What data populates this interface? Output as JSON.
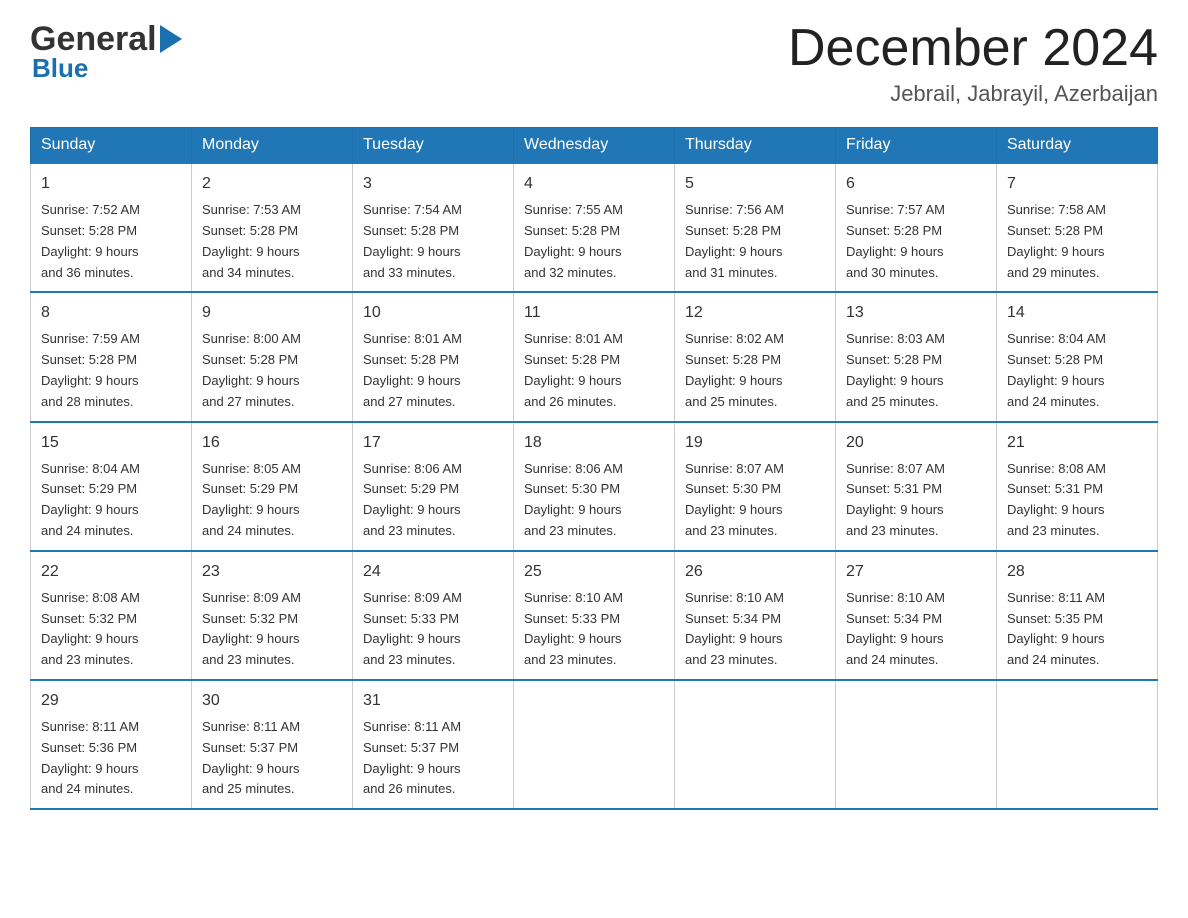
{
  "header": {
    "logo_line1": "General",
    "logo_arrow": "▶",
    "logo_line2": "Blue",
    "month_title": "December 2024",
    "location": "Jebrail, Jabrayil, Azerbaijan"
  },
  "calendar": {
    "days_of_week": [
      "Sunday",
      "Monday",
      "Tuesday",
      "Wednesday",
      "Thursday",
      "Friday",
      "Saturday"
    ],
    "weeks": [
      [
        {
          "day": "1",
          "info": "Sunrise: 7:52 AM\nSunset: 5:28 PM\nDaylight: 9 hours\nand 36 minutes."
        },
        {
          "day": "2",
          "info": "Sunrise: 7:53 AM\nSunset: 5:28 PM\nDaylight: 9 hours\nand 34 minutes."
        },
        {
          "day": "3",
          "info": "Sunrise: 7:54 AM\nSunset: 5:28 PM\nDaylight: 9 hours\nand 33 minutes."
        },
        {
          "day": "4",
          "info": "Sunrise: 7:55 AM\nSunset: 5:28 PM\nDaylight: 9 hours\nand 32 minutes."
        },
        {
          "day": "5",
          "info": "Sunrise: 7:56 AM\nSunset: 5:28 PM\nDaylight: 9 hours\nand 31 minutes."
        },
        {
          "day": "6",
          "info": "Sunrise: 7:57 AM\nSunset: 5:28 PM\nDaylight: 9 hours\nand 30 minutes."
        },
        {
          "day": "7",
          "info": "Sunrise: 7:58 AM\nSunset: 5:28 PM\nDaylight: 9 hours\nand 29 minutes."
        }
      ],
      [
        {
          "day": "8",
          "info": "Sunrise: 7:59 AM\nSunset: 5:28 PM\nDaylight: 9 hours\nand 28 minutes."
        },
        {
          "day": "9",
          "info": "Sunrise: 8:00 AM\nSunset: 5:28 PM\nDaylight: 9 hours\nand 27 minutes."
        },
        {
          "day": "10",
          "info": "Sunrise: 8:01 AM\nSunset: 5:28 PM\nDaylight: 9 hours\nand 27 minutes."
        },
        {
          "day": "11",
          "info": "Sunrise: 8:01 AM\nSunset: 5:28 PM\nDaylight: 9 hours\nand 26 minutes."
        },
        {
          "day": "12",
          "info": "Sunrise: 8:02 AM\nSunset: 5:28 PM\nDaylight: 9 hours\nand 25 minutes."
        },
        {
          "day": "13",
          "info": "Sunrise: 8:03 AM\nSunset: 5:28 PM\nDaylight: 9 hours\nand 25 minutes."
        },
        {
          "day": "14",
          "info": "Sunrise: 8:04 AM\nSunset: 5:28 PM\nDaylight: 9 hours\nand 24 minutes."
        }
      ],
      [
        {
          "day": "15",
          "info": "Sunrise: 8:04 AM\nSunset: 5:29 PM\nDaylight: 9 hours\nand 24 minutes."
        },
        {
          "day": "16",
          "info": "Sunrise: 8:05 AM\nSunset: 5:29 PM\nDaylight: 9 hours\nand 24 minutes."
        },
        {
          "day": "17",
          "info": "Sunrise: 8:06 AM\nSunset: 5:29 PM\nDaylight: 9 hours\nand 23 minutes."
        },
        {
          "day": "18",
          "info": "Sunrise: 8:06 AM\nSunset: 5:30 PM\nDaylight: 9 hours\nand 23 minutes."
        },
        {
          "day": "19",
          "info": "Sunrise: 8:07 AM\nSunset: 5:30 PM\nDaylight: 9 hours\nand 23 minutes."
        },
        {
          "day": "20",
          "info": "Sunrise: 8:07 AM\nSunset: 5:31 PM\nDaylight: 9 hours\nand 23 minutes."
        },
        {
          "day": "21",
          "info": "Sunrise: 8:08 AM\nSunset: 5:31 PM\nDaylight: 9 hours\nand 23 minutes."
        }
      ],
      [
        {
          "day": "22",
          "info": "Sunrise: 8:08 AM\nSunset: 5:32 PM\nDaylight: 9 hours\nand 23 minutes."
        },
        {
          "day": "23",
          "info": "Sunrise: 8:09 AM\nSunset: 5:32 PM\nDaylight: 9 hours\nand 23 minutes."
        },
        {
          "day": "24",
          "info": "Sunrise: 8:09 AM\nSunset: 5:33 PM\nDaylight: 9 hours\nand 23 minutes."
        },
        {
          "day": "25",
          "info": "Sunrise: 8:10 AM\nSunset: 5:33 PM\nDaylight: 9 hours\nand 23 minutes."
        },
        {
          "day": "26",
          "info": "Sunrise: 8:10 AM\nSunset: 5:34 PM\nDaylight: 9 hours\nand 23 minutes."
        },
        {
          "day": "27",
          "info": "Sunrise: 8:10 AM\nSunset: 5:34 PM\nDaylight: 9 hours\nand 24 minutes."
        },
        {
          "day": "28",
          "info": "Sunrise: 8:11 AM\nSunset: 5:35 PM\nDaylight: 9 hours\nand 24 minutes."
        }
      ],
      [
        {
          "day": "29",
          "info": "Sunrise: 8:11 AM\nSunset: 5:36 PM\nDaylight: 9 hours\nand 24 minutes."
        },
        {
          "day": "30",
          "info": "Sunrise: 8:11 AM\nSunset: 5:37 PM\nDaylight: 9 hours\nand 25 minutes."
        },
        {
          "day": "31",
          "info": "Sunrise: 8:11 AM\nSunset: 5:37 PM\nDaylight: 9 hours\nand 26 minutes."
        },
        {
          "day": "",
          "info": ""
        },
        {
          "day": "",
          "info": ""
        },
        {
          "day": "",
          "info": ""
        },
        {
          "day": "",
          "info": ""
        }
      ]
    ]
  }
}
